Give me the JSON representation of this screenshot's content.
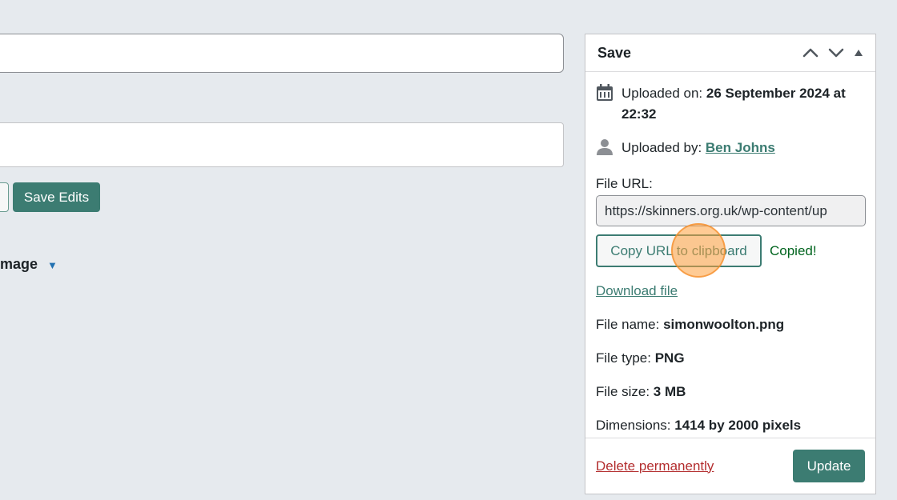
{
  "left": {
    "save_edits_label": "Save Edits",
    "edit_image_label": "mage"
  },
  "panel": {
    "title": "Save",
    "uploaded_on_label": "Uploaded on: ",
    "uploaded_on_value": "26 September 2024 at 22:32",
    "uploaded_by_label": "Uploaded by: ",
    "uploaded_by_value": "Ben Johns",
    "file_url_label": "File URL:",
    "file_url_value": "https://skinners.org.uk/wp-content/up",
    "copy_button_label": "Copy URL to clipboard",
    "copied_text": "Copied!",
    "download_label": "Download file",
    "file_name_label": "File name: ",
    "file_name_value": "simonwoolton.png",
    "file_type_label": "File type: ",
    "file_type_value": "PNG",
    "file_size_label": "File size: ",
    "file_size_value": "3 MB",
    "dimensions_label": "Dimensions: ",
    "dimensions_value": "1414 by 2000 pixels",
    "delete_label": "Delete permanently",
    "update_label": "Update"
  },
  "icons": {
    "calendar": "calendar-icon",
    "user": "user-icon",
    "move_up": "chevron-up-icon",
    "move_down": "chevron-down-icon",
    "collapse": "triangle-up-icon"
  },
  "colors": {
    "accent": "#3c7c72",
    "danger": "#b32d2e",
    "success": "#00641e",
    "background": "#e6eaee"
  }
}
